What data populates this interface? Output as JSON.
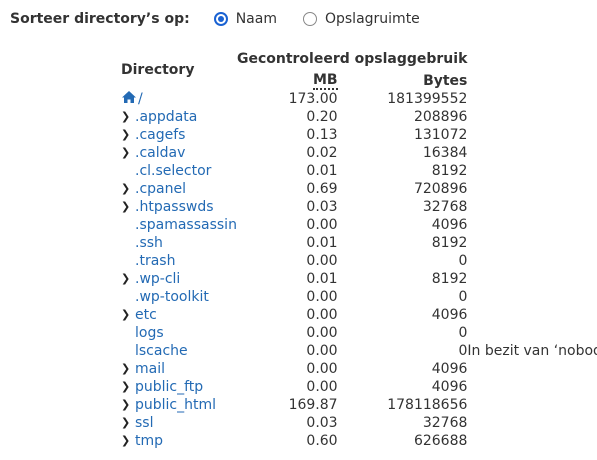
{
  "sort": {
    "label": "Sorteer directory’s op:",
    "options": [
      {
        "label": "Naam",
        "checked": true
      },
      {
        "label": "Opslagruimte",
        "checked": false
      }
    ]
  },
  "table": {
    "directory_header": "Directory",
    "group_header": "Gecontroleerd opslaggebruik",
    "mb_header": "MB",
    "bytes_header": "Bytes",
    "root": {
      "name": "/",
      "icon": "home-icon",
      "mb": "173.00",
      "bytes": "181399552"
    },
    "rows": [
      {
        "name": ".appdata",
        "expandable": true,
        "mb": "0.20",
        "bytes": "208896",
        "note": ""
      },
      {
        "name": ".cagefs",
        "expandable": true,
        "mb": "0.13",
        "bytes": "131072",
        "note": ""
      },
      {
        "name": ".caldav",
        "expandable": true,
        "mb": "0.02",
        "bytes": "16384",
        "note": ""
      },
      {
        "name": ".cl.selector",
        "expandable": false,
        "mb": "0.01",
        "bytes": "8192",
        "note": ""
      },
      {
        "name": ".cpanel",
        "expandable": true,
        "mb": "0.69",
        "bytes": "720896",
        "note": ""
      },
      {
        "name": ".htpasswds",
        "expandable": true,
        "mb": "0.03",
        "bytes": "32768",
        "note": ""
      },
      {
        "name": ".spamassassin",
        "expandable": false,
        "mb": "0.00",
        "bytes": "4096",
        "note": ""
      },
      {
        "name": ".ssh",
        "expandable": false,
        "mb": "0.01",
        "bytes": "8192",
        "note": ""
      },
      {
        "name": ".trash",
        "expandable": false,
        "mb": "0.00",
        "bytes": "0",
        "note": ""
      },
      {
        "name": ".wp-cli",
        "expandable": true,
        "mb": "0.01",
        "bytes": "8192",
        "note": ""
      },
      {
        "name": ".wp-toolkit",
        "expandable": false,
        "mb": "0.00",
        "bytes": "0",
        "note": ""
      },
      {
        "name": "etc",
        "expandable": true,
        "mb": "0.00",
        "bytes": "4096",
        "note": ""
      },
      {
        "name": "logs",
        "expandable": false,
        "mb": "0.00",
        "bytes": "0",
        "note": ""
      },
      {
        "name": "lscache",
        "expandable": false,
        "mb": "0.00",
        "bytes": "0",
        "note": "In bezit van ‘nobody’."
      },
      {
        "name": "mail",
        "expandable": true,
        "mb": "0.00",
        "bytes": "4096",
        "note": ""
      },
      {
        "name": "public_ftp",
        "expandable": true,
        "mb": "0.00",
        "bytes": "4096",
        "note": ""
      },
      {
        "name": "public_html",
        "expandable": true,
        "mb": "169.87",
        "bytes": "178118656",
        "note": ""
      },
      {
        "name": "ssl",
        "expandable": true,
        "mb": "0.03",
        "bytes": "32768",
        "note": ""
      },
      {
        "name": "tmp",
        "expandable": true,
        "mb": "0.60",
        "bytes": "626688",
        "note": ""
      }
    ]
  },
  "colors": {
    "link": "#236ab4",
    "radio_accent": "#1a62d2",
    "text": "#333333"
  },
  "icons": {
    "expand": "chevron-right-icon",
    "root": "home-icon"
  }
}
